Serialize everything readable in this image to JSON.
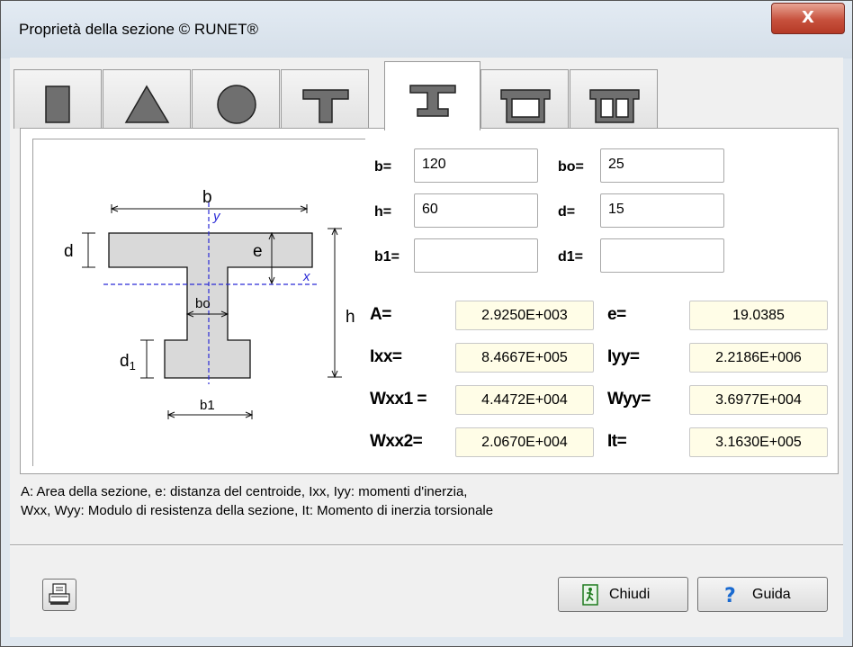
{
  "window": {
    "title": "Proprietà della sezione   © RUNET®",
    "close_label": "X"
  },
  "tabs": [
    {
      "icon": "rectangle-section-icon",
      "active": false
    },
    {
      "icon": "triangle-section-icon",
      "active": false
    },
    {
      "icon": "circle-section-icon",
      "active": false
    },
    {
      "icon": "t-section-icon",
      "active": false
    },
    {
      "icon": "i-section-icon",
      "active": true
    },
    {
      "icon": "box-section-icon",
      "active": false
    },
    {
      "icon": "double-box-section-icon",
      "active": false
    }
  ],
  "diagram": {
    "labels": {
      "b": "b",
      "y": "y",
      "d": "d",
      "e": "e",
      "x": "x",
      "bo": "bo",
      "h": "h",
      "d1": "d",
      "d1_sub": "1",
      "b1": "b1"
    }
  },
  "inputs": {
    "b": {
      "label": "b=",
      "value": "120"
    },
    "bo": {
      "label": "bo=",
      "value": "25"
    },
    "h": {
      "label": "h=",
      "value": "60"
    },
    "d": {
      "label": "d=",
      "value": "15"
    },
    "b1": {
      "label": "b1=",
      "value": ""
    },
    "d1": {
      "label": "d1=",
      "value": ""
    }
  },
  "results": {
    "A": {
      "label": "A=",
      "value": "2.9250E+003"
    },
    "e": {
      "label": "e=",
      "value": "19.0385"
    },
    "Ixx": {
      "label": "Ixx=",
      "value": "8.4667E+005"
    },
    "Iyy": {
      "label": "Iyy=",
      "value": "2.2186E+006"
    },
    "Wxx1": {
      "label": "Wxx1 =",
      "value": "4.4472E+004"
    },
    "Wyy": {
      "label": "Wyy=",
      "value": "3.6977E+004"
    },
    "Wxx2": {
      "label": "Wxx2=",
      "value": "2.0670E+004"
    },
    "It": {
      "label": "It=",
      "value": "3.1630E+005"
    }
  },
  "legend": {
    "line1": "A: Area della sezione, e: distanza del centroide, Ixx, Iyy: momenti d'inerzia,",
    "line2": "Wxx, Wyy: Modulo di resistenza della sezione, It: Momento di inerzia torsionale"
  },
  "buttons": {
    "print_icon": "printer-icon",
    "close_label": "Chiudi",
    "help_label": "Guida"
  },
  "colors": {
    "axis": "#2b2bd6",
    "shape_fill": "#d9d9d9",
    "result_bg": "#fffde7",
    "close_red": "#c7513d"
  }
}
